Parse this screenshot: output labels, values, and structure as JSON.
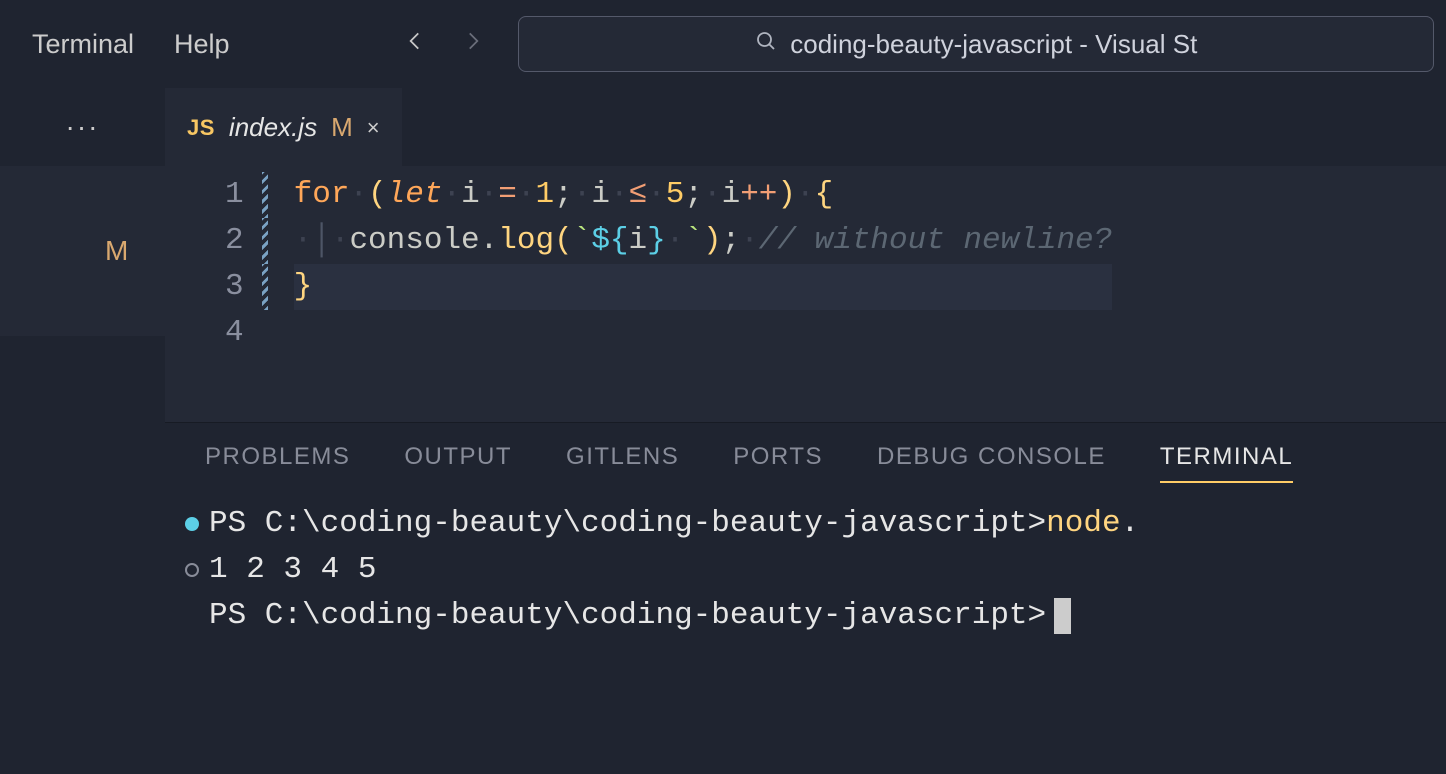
{
  "menu": {
    "terminal": "Terminal",
    "help": "Help"
  },
  "search": {
    "text": "coding-beauty-javascript - Visual St"
  },
  "tab": {
    "js_badge": "JS",
    "filename": "index.js",
    "modified": "M",
    "close": "×"
  },
  "sidebar": {
    "modified_badge": "M"
  },
  "editor": {
    "line_numbers": [
      "1",
      "2",
      "3",
      "4"
    ],
    "code": {
      "line1": {
        "for": "for",
        "let": "let",
        "var": "i",
        "eq": "=",
        "one": "1",
        "semi1": ";",
        "leq": "≤",
        "five": "5",
        "semi2": ";",
        "inc": "i++",
        "brace": "{"
      },
      "line2": {
        "indent": "··",
        "obj": "console",
        "dot": ".",
        "method": "log",
        "btk1": "`",
        "d1": "$",
        "lb": "{",
        "ivar": "i",
        "rb": "}",
        "sp": "·",
        "btk2": "`",
        "semi": ";",
        "comment": "// without newline?"
      },
      "line3": {
        "brace": "}"
      }
    }
  },
  "panel_tabs": {
    "problems": "PROBLEMS",
    "output": "OUTPUT",
    "gitlens": "GITLENS",
    "ports": "PORTS",
    "debug": "DEBUG CONSOLE",
    "terminal": "TERMINAL"
  },
  "terminal": {
    "prompt1": "PS C:\\coding-beauty\\coding-beauty-javascript> ",
    "cmd_node": "node",
    "cmd_args": "  .",
    "output": "1 2 3 4 5",
    "prompt2": "PS C:\\coding-beauty\\coding-beauty-javascript>"
  }
}
